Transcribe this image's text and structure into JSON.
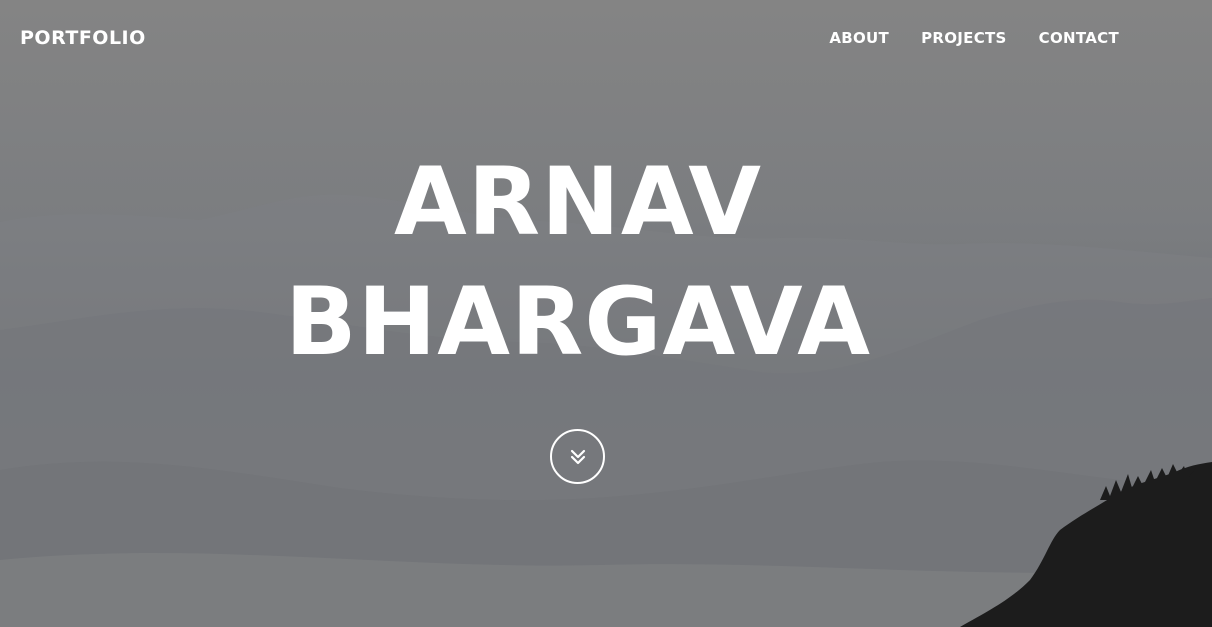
{
  "navbar": {
    "brand": "PORTFOLIO",
    "links": [
      {
        "label": "ABOUT"
      },
      {
        "label": "PROJECTS"
      },
      {
        "label": "CONTACT"
      }
    ]
  },
  "hero": {
    "title_line1": "ARNAV",
    "title_line2": "BHARGAVA",
    "scroll_icon": "chevron-double-down-icon",
    "background": "grayscale misty mountains"
  },
  "colors": {
    "text": "#ffffff",
    "overlay": "#7a7c7f",
    "foreground_rock": "#1c1c1c"
  }
}
